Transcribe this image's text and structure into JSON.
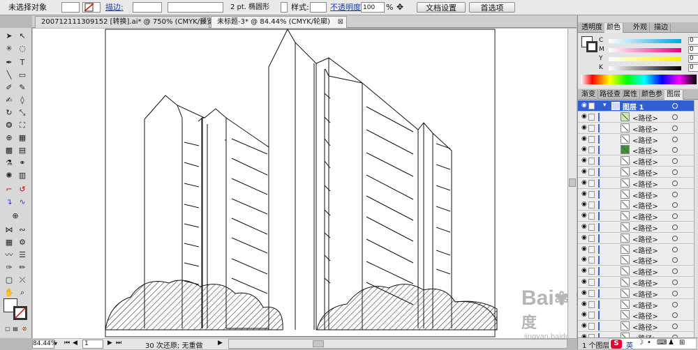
{
  "control": {
    "selection": "未选择对象",
    "stroke_label": "描边:",
    "stroke_size": "2 pt. 椭圆形",
    "style_label": "样式:",
    "opacity_label": "不透明度:",
    "opacity_value": "100",
    "percent": "%",
    "doc_setup": "文档设置",
    "prefs": "首选项"
  },
  "tabs": [
    {
      "label": "200712111309152 [转换].ai* @ 750% (CMYK/预览)",
      "close": "⊠"
    },
    {
      "label": "未标题-3* @ 84.44% (CMYK/轮廓)",
      "close": "⊠"
    }
  ],
  "status": {
    "zoom": "84.44%",
    "page": "1",
    "history": "30 次还原; 无重做"
  },
  "color_panel": {
    "tabs": [
      "透明度",
      "颜色",
      "外观",
      "描边"
    ],
    "rows": [
      {
        "label": "C",
        "value": "0",
        "unit": "%"
      },
      {
        "label": "M",
        "value": "0",
        "unit": "%"
      },
      {
        "label": "Y",
        "value": "0",
        "unit": "%"
      },
      {
        "label": "K",
        "value": "0",
        "unit": "%"
      }
    ]
  },
  "layers_panel": {
    "tabs": [
      "渐变",
      "路径查",
      "属性",
      "颜色参",
      "图层"
    ],
    "layer_name": "图层 1",
    "items": [
      "<路径>",
      "<路径>",
      "<路径>",
      "<路径>",
      "<路径>",
      "<路径>",
      "<路径>",
      "<路径>",
      "<路径>",
      "<路径>",
      "<路径>",
      "<路径>",
      "<路径>",
      "<路径>",
      "<路径>",
      "<路径>",
      "<路径>",
      "<路径>",
      "<路径>",
      "<路径>",
      "<路径>"
    ],
    "footer": "1 个图层"
  },
  "watermark": {
    "brand": "Bai",
    "brand2": "百度",
    "sub": "jingyan.baidu.com"
  },
  "ime": {
    "label": "英"
  },
  "colors": {
    "accent": "#3a62d8",
    "panel": "#d6d6d6",
    "canvas": "#ffffff"
  }
}
